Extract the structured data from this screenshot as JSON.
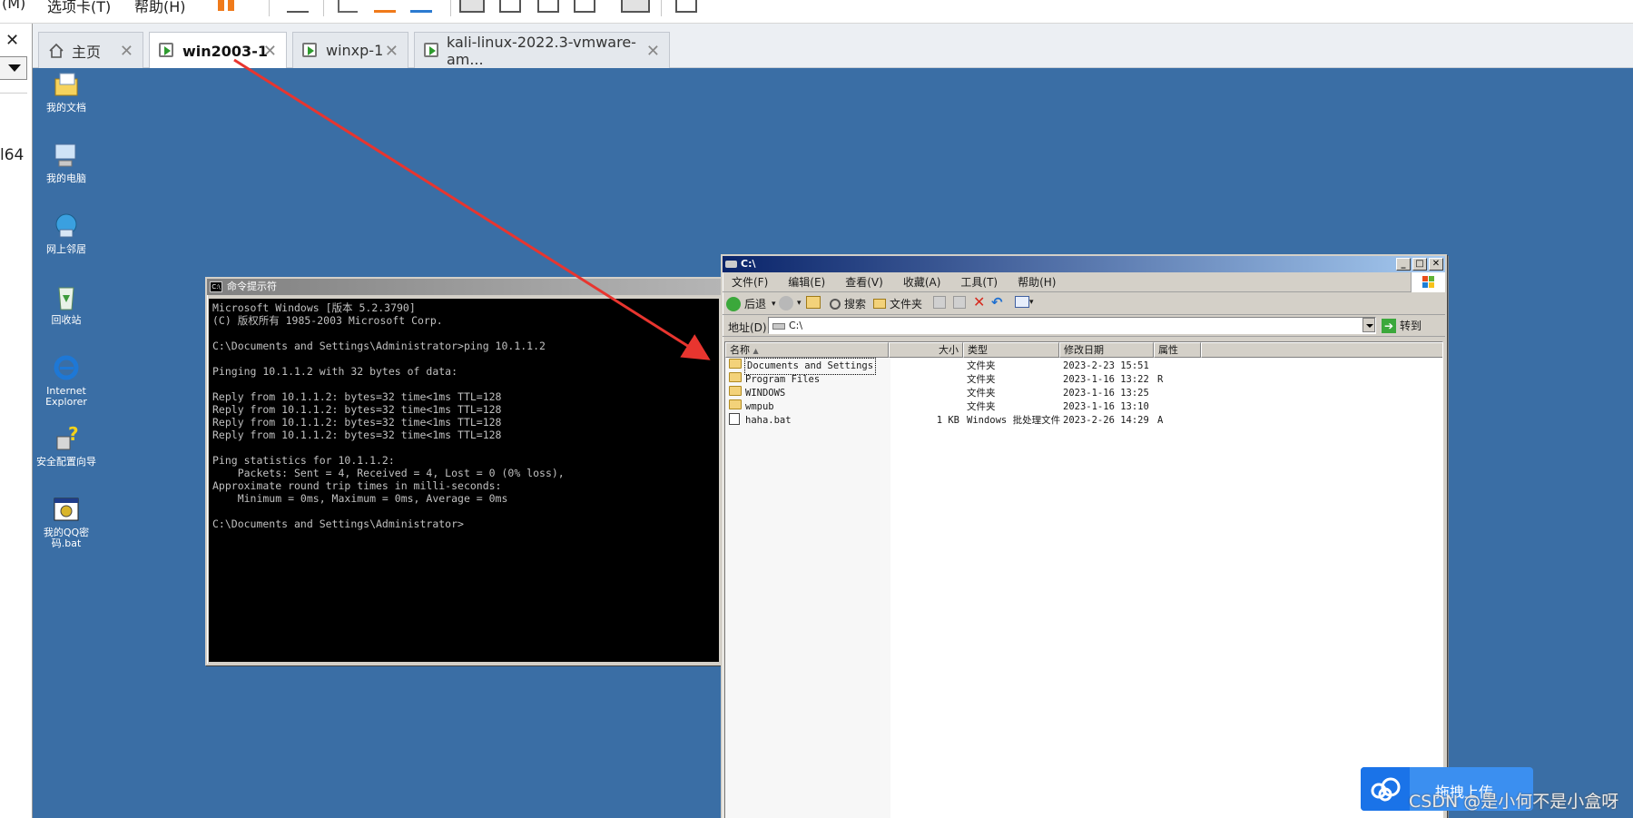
{
  "vmware": {
    "menu": [
      "(M)",
      "选项卡(T)",
      "帮助(H)"
    ],
    "left_pane_text": "l64",
    "tabs": [
      {
        "label": "主页",
        "icon": "home-icon"
      },
      {
        "label": "win2003-1",
        "icon": "vm-running-icon",
        "active": true
      },
      {
        "label": "winxp-1",
        "icon": "vm-running-icon"
      },
      {
        "label": "kali-linux-2022.3-vmware-am...",
        "icon": "vm-running-icon"
      }
    ],
    "close_glyph": "✕"
  },
  "desktop": {
    "icons": [
      {
        "label": "我的文档",
        "icon": "my-documents-icon"
      },
      {
        "label": "我的电脑",
        "icon": "my-computer-icon"
      },
      {
        "label": "网上邻居",
        "icon": "network-places-icon"
      },
      {
        "label": "回收站",
        "icon": "recycle-bin-icon"
      },
      {
        "label": "Internet Explorer",
        "icon": "internet-explorer-icon"
      },
      {
        "label": "安全配置向导",
        "icon": "security-wizard-icon"
      },
      {
        "label": "我的QQ密码.bat",
        "icon": "batch-file-icon"
      }
    ]
  },
  "cmd": {
    "title": "命令提示符",
    "icon_text": "C:\\",
    "lines": [
      "Microsoft Windows [版本 5.2.3790]",
      "(C) 版权所有 1985-2003 Microsoft Corp.",
      "",
      "C:\\Documents and Settings\\Administrator>ping 10.1.1.2",
      "",
      "Pinging 10.1.1.2 with 32 bytes of data:",
      "",
      "Reply from 10.1.1.2: bytes=32 time<1ms TTL=128",
      "Reply from 10.1.1.2: bytes=32 time<1ms TTL=128",
      "Reply from 10.1.1.2: bytes=32 time<1ms TTL=128",
      "Reply from 10.1.1.2: bytes=32 time<1ms TTL=128",
      "",
      "Ping statistics for 10.1.1.2:",
      "    Packets: Sent = 4, Received = 4, Lost = 0 (0% loss),",
      "Approximate round trip times in milli-seconds:",
      "    Minimum = 0ms, Maximum = 0ms, Average = 0ms",
      "",
      "C:\\Documents and Settings\\Administrator>"
    ]
  },
  "explorer": {
    "title": "C:\\",
    "window_buttons": {
      "minimize": "_",
      "maximize": "□",
      "close": "✕"
    },
    "menu": [
      "文件(F)",
      "编辑(E)",
      "查看(V)",
      "收藏(A)",
      "工具(T)",
      "帮助(H)"
    ],
    "toolbar": {
      "back": "后退",
      "search": "搜索",
      "folders": "文件夹"
    },
    "address": {
      "label": "地址(D)",
      "value": "C:\\",
      "go": "转到"
    },
    "columns": [
      "名称",
      "大小",
      "类型",
      "修改日期",
      "属性"
    ],
    "files": [
      {
        "name": "Documents and Settings",
        "size": "",
        "type": "文件夹",
        "modified": "2023-2-23 15:51",
        "attr": "",
        "kind": "folder"
      },
      {
        "name": "Program Files",
        "size": "",
        "type": "文件夹",
        "modified": "2023-1-16 13:22",
        "attr": "R",
        "kind": "folder"
      },
      {
        "name": "WINDOWS",
        "size": "",
        "type": "文件夹",
        "modified": "2023-1-16 13:25",
        "attr": "",
        "kind": "folder"
      },
      {
        "name": "wmpub",
        "size": "",
        "type": "文件夹",
        "modified": "2023-1-16 13:10",
        "attr": "",
        "kind": "folder"
      },
      {
        "name": "haha.bat",
        "size": "1 KB",
        "type": "Windows 批处理文件",
        "modified": "2023-2-26 14:29",
        "attr": "A",
        "kind": "bat"
      }
    ]
  },
  "overlay": {
    "upload_label": "拖拽上传",
    "watermark": "CSDN @是小何不是小盒呀",
    "arrow_color": "#e8352f"
  }
}
